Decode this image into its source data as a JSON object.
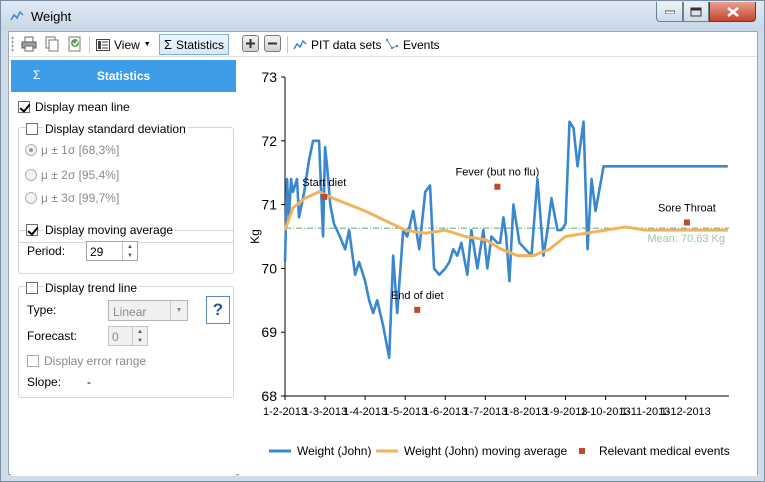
{
  "window": {
    "title": "Weight"
  },
  "toolbar": {
    "view_label": "View",
    "statistics_label": "Statistics",
    "pit_label": "PIT data sets",
    "events_label": "Events"
  },
  "sidebar": {
    "header": "Statistics",
    "mean_line_label": "Display mean line",
    "std_dev_label": "Display standard deviation",
    "sigma_options": [
      "μ ± 1σ [68,3%]",
      "μ ± 2σ [95,4%]",
      "μ ± 3σ [99,7%]"
    ],
    "moving_avg_label": "Display moving average",
    "period_label": "Period:",
    "period_value": "29",
    "trend_label": "Display trend line",
    "type_label": "Type:",
    "type_value": "Linear",
    "forecast_label": "Forecast:",
    "forecast_value": "0",
    "error_range_label": "Display error range",
    "slope_label": "Slope:",
    "slope_value": "-",
    "help_label": "?"
  },
  "state": {
    "mean_line_checked": true,
    "std_dev_checked": false,
    "moving_avg_checked": true,
    "trend_checked": false,
    "error_range_checked": false,
    "selected_sigma": 0
  },
  "colors": {
    "accent": "#3d9ce8",
    "weight_line": "#3a87cf",
    "moving_avg_line": "#f1b35a",
    "mean_line": "#6cae86",
    "event_marker": "#c0482f"
  },
  "chart_data": {
    "type": "line",
    "ylabel": "Kg",
    "ylim": [
      68,
      73
    ],
    "yticks": [
      68,
      69,
      70,
      71,
      72,
      73
    ],
    "xlim": [
      0,
      11.08
    ],
    "xtick_labels": [
      "1-2-2013",
      "1-3-2013",
      "1-4-2013",
      "1-5-2013",
      "1-6-2013",
      "1-7-2013",
      "1-8-2013",
      "1-9-2013",
      "1-10-2013",
      "1-11-2013",
      "1-12-2013"
    ],
    "mean": {
      "value": 70.63,
      "label": "Mean: 70,63 Kg"
    },
    "series": [
      {
        "name": "Weight (John)",
        "x": [
          0,
          0.05,
          0.1,
          0.15,
          0.2,
          0.3,
          0.35,
          0.48,
          0.6,
          0.7,
          0.85,
          0.95,
          1.0,
          1.05,
          1.13,
          1.22,
          1.37,
          1.5,
          1.6,
          1.75,
          1.85,
          2.0,
          2.1,
          2.2,
          2.3,
          2.45,
          2.6,
          2.7,
          2.8,
          2.95,
          3.05,
          3.2,
          3.35,
          3.5,
          3.62,
          3.72,
          3.85,
          4.0,
          4.1,
          4.2,
          4.3,
          4.4,
          4.55,
          4.65,
          4.8,
          4.95,
          5.05,
          5.15,
          5.3,
          5.37,
          5.45,
          5.52,
          5.6,
          5.7,
          5.85,
          6.0,
          6.15,
          6.3,
          6.45,
          6.55,
          6.65,
          6.8,
          6.9,
          7.0,
          7.1,
          7.2,
          7.3,
          7.45,
          7.55,
          7.65,
          7.75,
          7.95,
          8.15,
          8.3,
          8.45,
          8.55,
          8.7,
          8.8,
          9.0,
          9.2,
          9.35,
          9.55,
          9.75,
          9.9,
          10.02,
          10.15,
          10.25,
          10.45,
          10.6,
          10.7,
          11.05
        ],
        "values": [
          70.1,
          71.4,
          70.8,
          71.4,
          71.2,
          71.4,
          70.8,
          71.2,
          71.7,
          72.0,
          72.0,
          70.5,
          71.9,
          71.6,
          71.0,
          70.7,
          70.5,
          70.3,
          70.6,
          69.9,
          70.1,
          69.8,
          69.5,
          69.3,
          69.5,
          69.1,
          68.6,
          70.2,
          69.3,
          70.6,
          70.5,
          70.9,
          70.3,
          71.2,
          71.3,
          70.0,
          69.9,
          70.0,
          70.1,
          70.3,
          70.2,
          70.4,
          69.9,
          70.6,
          70.0,
          70.6,
          70.0,
          70.5,
          70.4,
          70.4,
          70.8,
          70.5,
          69.8,
          71.0,
          70.4,
          70.3,
          70.2,
          71.4,
          70.2,
          70.6,
          71.1,
          70.6,
          70.6,
          70.7,
          72.3,
          72.2,
          71.6,
          72.3,
          70.3,
          71.4,
          70.9,
          71.6,
          71.6,
          71.6,
          71.6,
          71.6,
          71.6,
          71.6,
          71.6,
          71.6,
          71.6,
          71.6,
          71.6,
          71.6,
          71.6,
          71.6,
          71.6,
          71.6,
          71.6,
          71.6,
          71.6
        ]
      },
      {
        "name": "Weight (John) moving average",
        "x": [
          0,
          0.2,
          0.5,
          0.85,
          1.2,
          1.6,
          2.0,
          2.5,
          3.0,
          3.5,
          4.0,
          4.5,
          5.0,
          5.4,
          5.8,
          6.2,
          6.6,
          7.0,
          7.5,
          8.0,
          8.5,
          9.0,
          9.5,
          10.0,
          10.5,
          11.05
        ],
        "values": [
          70.6,
          70.95,
          71.1,
          71.2,
          71.1,
          71.0,
          70.9,
          70.75,
          70.6,
          70.55,
          70.6,
          70.5,
          70.45,
          70.3,
          70.2,
          70.2,
          70.3,
          70.5,
          70.55,
          70.6,
          70.65,
          70.6,
          70.6,
          70.6,
          70.6,
          70.6
        ]
      },
      {
        "name": "Relevant medical events",
        "events": [
          {
            "label": "Start diet",
            "x": 0.98,
            "y": 71.12
          },
          {
            "label": "End of diet",
            "x": 3.3,
            "y": 69.35
          },
          {
            "label": "Fever (but no flu)",
            "x": 5.3,
            "y": 71.28
          },
          {
            "label": "Sore Throat",
            "x": 10.03,
            "y": 70.72
          }
        ]
      }
    ],
    "legend": [
      "Weight (John)",
      "Weight (John) moving average",
      "Relevant medical events"
    ],
    "legend_position": "bottom",
    "grid": false
  }
}
